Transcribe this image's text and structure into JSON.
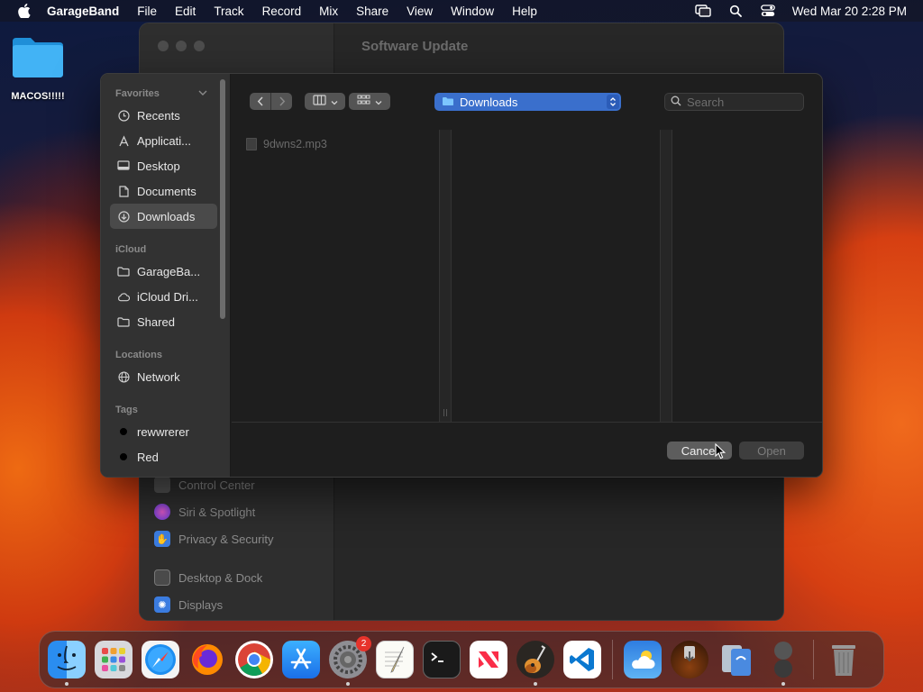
{
  "menubar": {
    "app_name": "GarageBand",
    "items": [
      "File",
      "Edit",
      "Track",
      "Record",
      "Mix",
      "Share",
      "View",
      "Window",
      "Help"
    ],
    "datetime": "Wed Mar 20  2:28 PM"
  },
  "desktop": {
    "folder_label": "MACOS!!!!!"
  },
  "settings_window": {
    "title": "Software Update",
    "items": [
      {
        "label": "Control Center",
        "icon": "control-center-icon",
        "color": "#5a5a5a"
      },
      {
        "label": "Siri & Spotlight",
        "icon": "siri-icon",
        "color": "#b04ad0"
      },
      {
        "label": "Privacy & Security",
        "icon": "hand-icon",
        "color": "#3b7ce0"
      },
      {
        "label": "Desktop & Dock",
        "icon": "dock-icon",
        "color": "#4a4a4a"
      },
      {
        "label": "Displays",
        "icon": "displays-icon",
        "color": "#3b7ce0"
      }
    ]
  },
  "dialog": {
    "sidebar": {
      "favorites_header": "Favorites",
      "favorites": [
        {
          "label": "Recents",
          "icon": "clock-icon"
        },
        {
          "label": "Applicati...",
          "icon": "applications-icon"
        },
        {
          "label": "Desktop",
          "icon": "desktop-icon"
        },
        {
          "label": "Documents",
          "icon": "document-icon"
        },
        {
          "label": "Downloads",
          "icon": "download-icon",
          "selected": true
        }
      ],
      "icloud_header": "iCloud",
      "icloud": [
        {
          "label": "GarageBa...",
          "icon": "folder-icon"
        },
        {
          "label": "iCloud Dri...",
          "icon": "cloud-icon"
        },
        {
          "label": "Shared",
          "icon": "shared-folder-icon"
        }
      ],
      "locations_header": "Locations",
      "locations": [
        {
          "label": "Network",
          "icon": "globe-icon"
        }
      ],
      "tags_header": "Tags",
      "tags": [
        {
          "label": "rewwrerer",
          "color": "#000000"
        },
        {
          "label": "Red",
          "color": "#000000"
        }
      ]
    },
    "toolbar": {
      "location": "Downloads",
      "search_placeholder": "Search"
    },
    "files": [
      {
        "name": "9dwns2.mp3",
        "enabled": false
      }
    ],
    "buttons": {
      "cancel": "Cancel",
      "open": "Open"
    }
  },
  "dock": {
    "apps": [
      {
        "name": "Finder",
        "icon": "finder-icon",
        "running": true
      },
      {
        "name": "Launchpad",
        "icon": "launchpad-icon",
        "running": false
      },
      {
        "name": "Safari",
        "icon": "safari-icon",
        "running": false
      },
      {
        "name": "Firefox",
        "icon": "firefox-icon",
        "running": false
      },
      {
        "name": "Chrome",
        "icon": "chrome-icon",
        "running": false
      },
      {
        "name": "App Store",
        "icon": "app-store-icon",
        "running": false
      },
      {
        "name": "System Settings",
        "icon": "system-settings-icon",
        "running": true,
        "badge": "2"
      },
      {
        "name": "TextEdit",
        "icon": "textedit-icon",
        "running": false
      },
      {
        "name": "Terminal",
        "icon": "terminal-icon",
        "running": false
      },
      {
        "name": "News",
        "icon": "news-icon",
        "running": false
      },
      {
        "name": "GarageBand",
        "icon": "garageband-icon",
        "running": true
      },
      {
        "name": "VS Code",
        "icon": "vscode-icon",
        "running": false
      }
    ],
    "recent_apps": [
      {
        "name": "Weather",
        "icon": "weather-icon",
        "running": false
      },
      {
        "name": "macOS Installer",
        "icon": "installer-icon",
        "running": false
      },
      {
        "name": "Migration Assistant",
        "icon": "migration-icon",
        "running": false
      },
      {
        "name": "Preview",
        "icon": "preview-icon",
        "running": true
      }
    ],
    "trash": {
      "name": "Trash",
      "icon": "trash-icon"
    }
  }
}
